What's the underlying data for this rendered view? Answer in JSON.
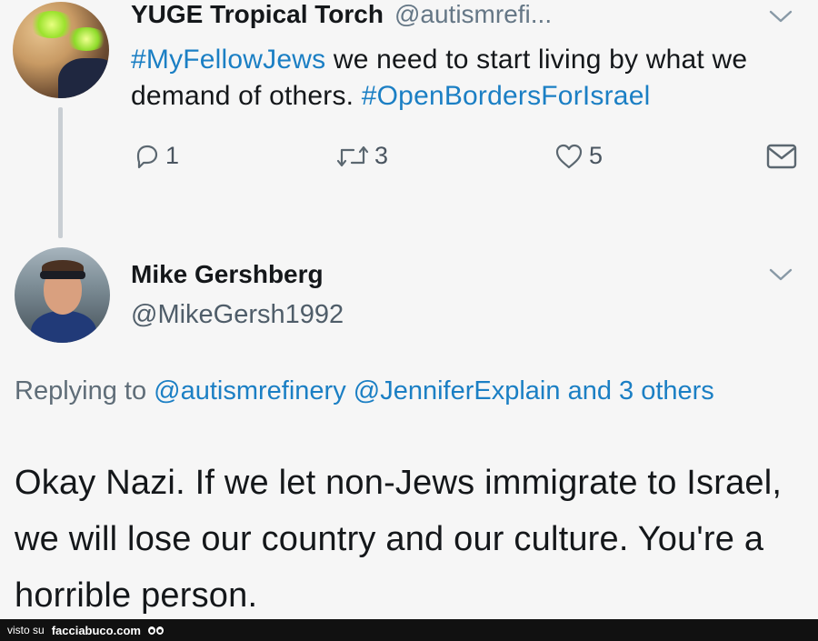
{
  "tweet1": {
    "name": "YUGE Tropical Torch",
    "handle": "@autismrefi...",
    "body_parts": {
      "hashtag1": "#MyFellowJews",
      "text1": " we need to start living by what we demand of others. ",
      "hashtag2": "#OpenBordersForIsrael"
    },
    "replies": "1",
    "retweets": "3",
    "likes": "5"
  },
  "tweet2": {
    "name": "Mike Gershberg",
    "handle": "@MikeGersh1992",
    "reply_prefix": "Replying to ",
    "mention1": "@autismrefinery",
    "mention2": "@JenniferExplain",
    "mention3": "and 3 others",
    "body": "Okay Nazi. If we let non-Jews immigrate to Israel, we will lose our country and our culture. You're a horrible person."
  },
  "footer": {
    "prefix": "visto su",
    "site": "facciabuco.com"
  },
  "colors": {
    "link": "#1b7fc4",
    "text": "#14171a",
    "muted": "#657786",
    "thread_line": "#c9ced3"
  },
  "icons": [
    "chevron-down-icon",
    "reply-icon",
    "retweet-icon",
    "like-icon",
    "message-icon"
  ]
}
